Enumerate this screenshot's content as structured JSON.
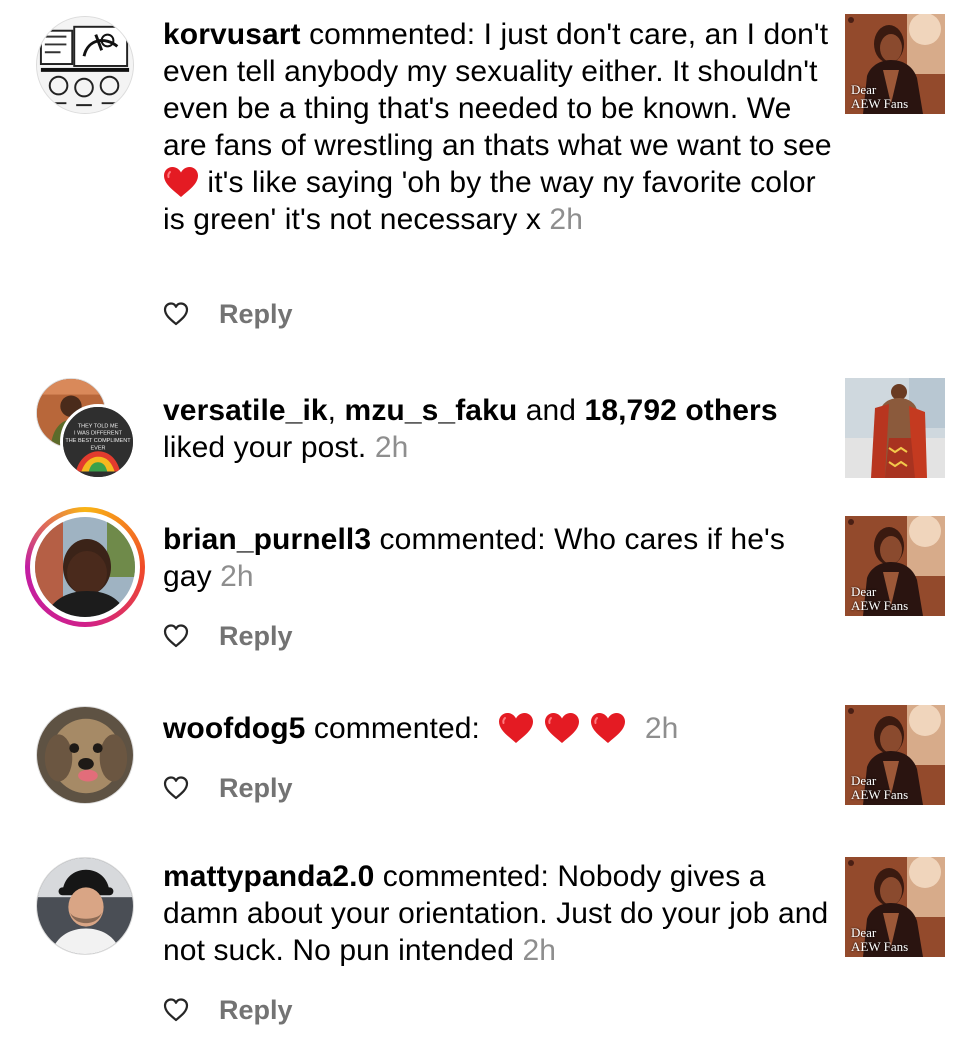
{
  "notifications": [
    {
      "type": "comment",
      "username": "korvusart",
      "action": " commented: ",
      "text": "I just don't care, an I don't even tell anybody my sexuality either. It shouldn't even be a thing that's needed to be known. We are fans of wrestling an thats what we want to see ",
      "emoji": "red-heart",
      "text_after": " it's like saying 'oh by the way ny favorite color is green' it's not necessary x",
      "time": "2h",
      "reply_label": "Reply",
      "thumb_caption_1": "Dear",
      "thumb_caption_2": "AEW Fans"
    },
    {
      "type": "like",
      "user1": "versatile_ik",
      "sep": ", ",
      "user2": "mzu_s_faku",
      "and": " and ",
      "others_count": "18,792 others",
      "action": " liked your post.",
      "time": "2h",
      "avatar_sign_text": "THEY TOLD ME I WAS DIFFERENT THE BEST COMPLIMENT EVER"
    },
    {
      "type": "comment",
      "username": "brian_purnell3",
      "action": " commented: ",
      "text": "Who cares if he's gay",
      "time": "2h",
      "reply_label": "Reply",
      "thumb_caption_1": "Dear",
      "thumb_caption_2": "AEW Fans"
    },
    {
      "type": "comment",
      "username": "woofdog5",
      "action": " commented:",
      "emojis": [
        "red-heart",
        "red-heart",
        "red-heart"
      ],
      "time": "2h",
      "reply_label": "Reply",
      "thumb_caption_1": "Dear",
      "thumb_caption_2": "AEW Fans"
    },
    {
      "type": "comment",
      "username": "mattypanda2.0",
      "action": " commented: ",
      "text": "Nobody gives a damn about your orientation. Just do your job and not suck. No pun intended",
      "time": "2h",
      "reply_label": "Reply",
      "thumb_caption_1": "Dear",
      "thumb_caption_2": "AEW Fans"
    }
  ],
  "colors": {
    "text": "#000000",
    "secondary": "#8e8e8e",
    "reply": "#737373",
    "heart": "#e41b23",
    "story_ring": [
      "#f9b515",
      "#d0208a"
    ]
  },
  "icons": [
    "heart-outline-icon",
    "red-heart-emoji"
  ]
}
